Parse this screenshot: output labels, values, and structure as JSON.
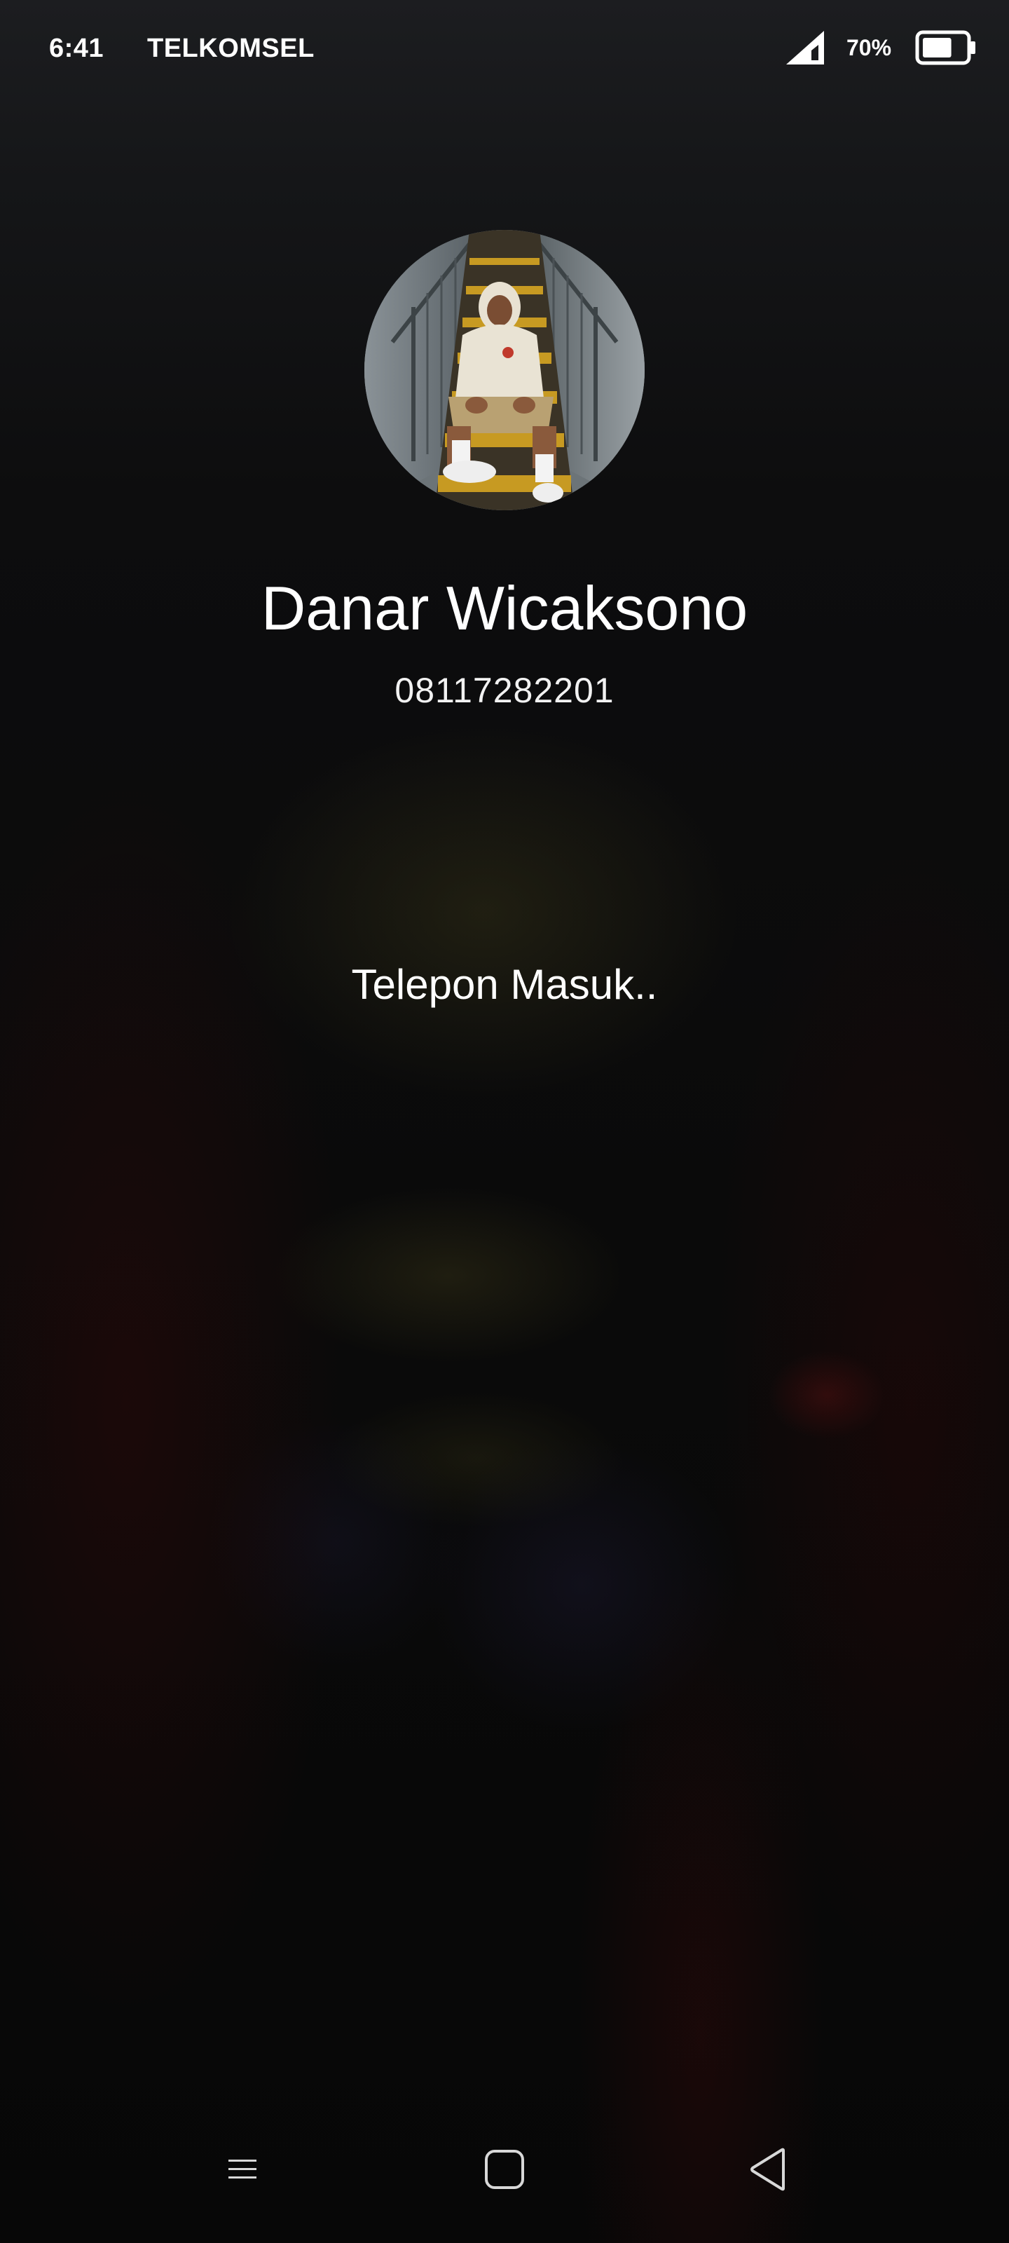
{
  "status_bar": {
    "time": "6:41",
    "carrier": "TELKOMSEL",
    "signal_icon": "cellular-signal-icon",
    "battery_percent": "70%",
    "battery_level": 0.7,
    "battery_icon": "battery-icon"
  },
  "caller": {
    "name": "Danar Wicaksono",
    "number": "08117282201",
    "avatar": "caller-photo"
  },
  "call": {
    "status": "Telepon Masuk.."
  },
  "nav_bar": {
    "menu_icon": "menu-icon",
    "home_icon": "home-square-icon",
    "back_icon": "back-triangle-icon"
  },
  "colors": {
    "text": "#ffffff",
    "background": "#0b0b0c"
  }
}
